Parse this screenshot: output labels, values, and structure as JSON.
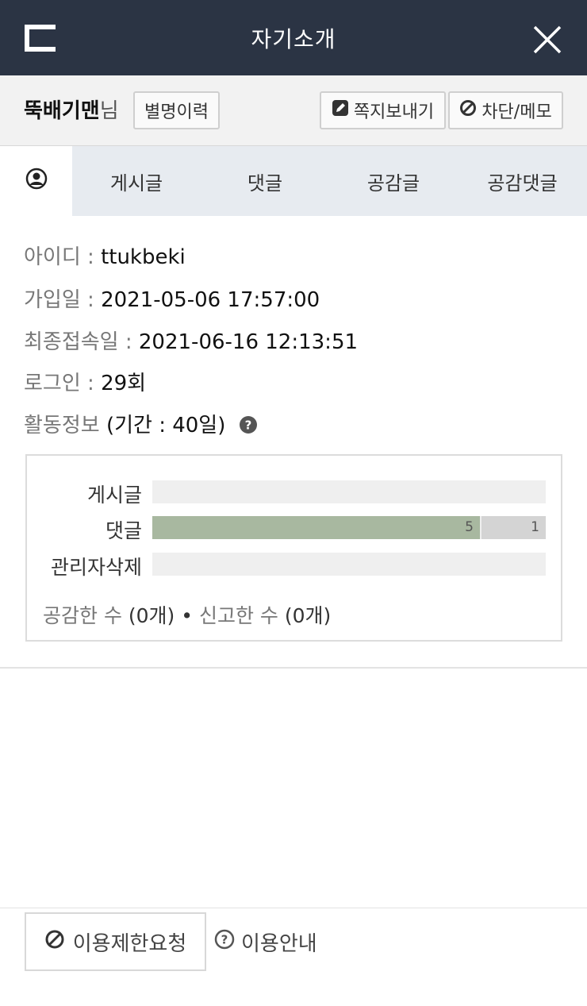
{
  "header": {
    "title": "자기소개",
    "back_icon": "back-bracket-icon",
    "close_icon": "close-icon"
  },
  "profile": {
    "nickname": "뚝배기맨",
    "suffix": "님",
    "history_label": "별명이력",
    "message_label": "쪽지보내기",
    "block_label": "차단/메모"
  },
  "tabs": [
    {
      "id": "profile",
      "icon": "user-circle-icon"
    },
    {
      "id": "posts",
      "label": "게시글"
    },
    {
      "id": "comments",
      "label": "댓글"
    },
    {
      "id": "liked-posts",
      "label": "공감글"
    },
    {
      "id": "liked-comments",
      "label": "공감댓글"
    }
  ],
  "info": {
    "id_label": "아이디 : ",
    "id_value": "ttukbeki",
    "joined_label": "가입일 : ",
    "joined_value": "2021-05-06 17:57:00",
    "last_login_label": "최종접속일 : ",
    "last_login_value": "2021-06-16 12:13:51",
    "login_label": "로그인 : ",
    "login_value": "29회",
    "activity_label": "활동정보",
    "activity_period": " (기간 : 40일)"
  },
  "activity": {
    "rows": [
      {
        "label": "게시글",
        "primary": 0,
        "secondary": 0
      },
      {
        "label": "댓글",
        "primary": 5,
        "secondary": 1,
        "primary_text": "5",
        "secondary_text": "1"
      },
      {
        "label": "관리자삭제",
        "primary": 0,
        "secondary": 0
      }
    ],
    "likes_label": "공감한 수",
    "likes_value": " (0개)",
    "separator": " • ",
    "reports_label": "신고한 수",
    "reports_value": " (0개)"
  },
  "footer": {
    "restrict_label": "이용제한요청",
    "guide_label": "이용안내"
  },
  "colors": {
    "header_bg": "#2b3444",
    "bar_primary": "#a8b8a0",
    "bar_secondary": "#d4d4d4"
  }
}
